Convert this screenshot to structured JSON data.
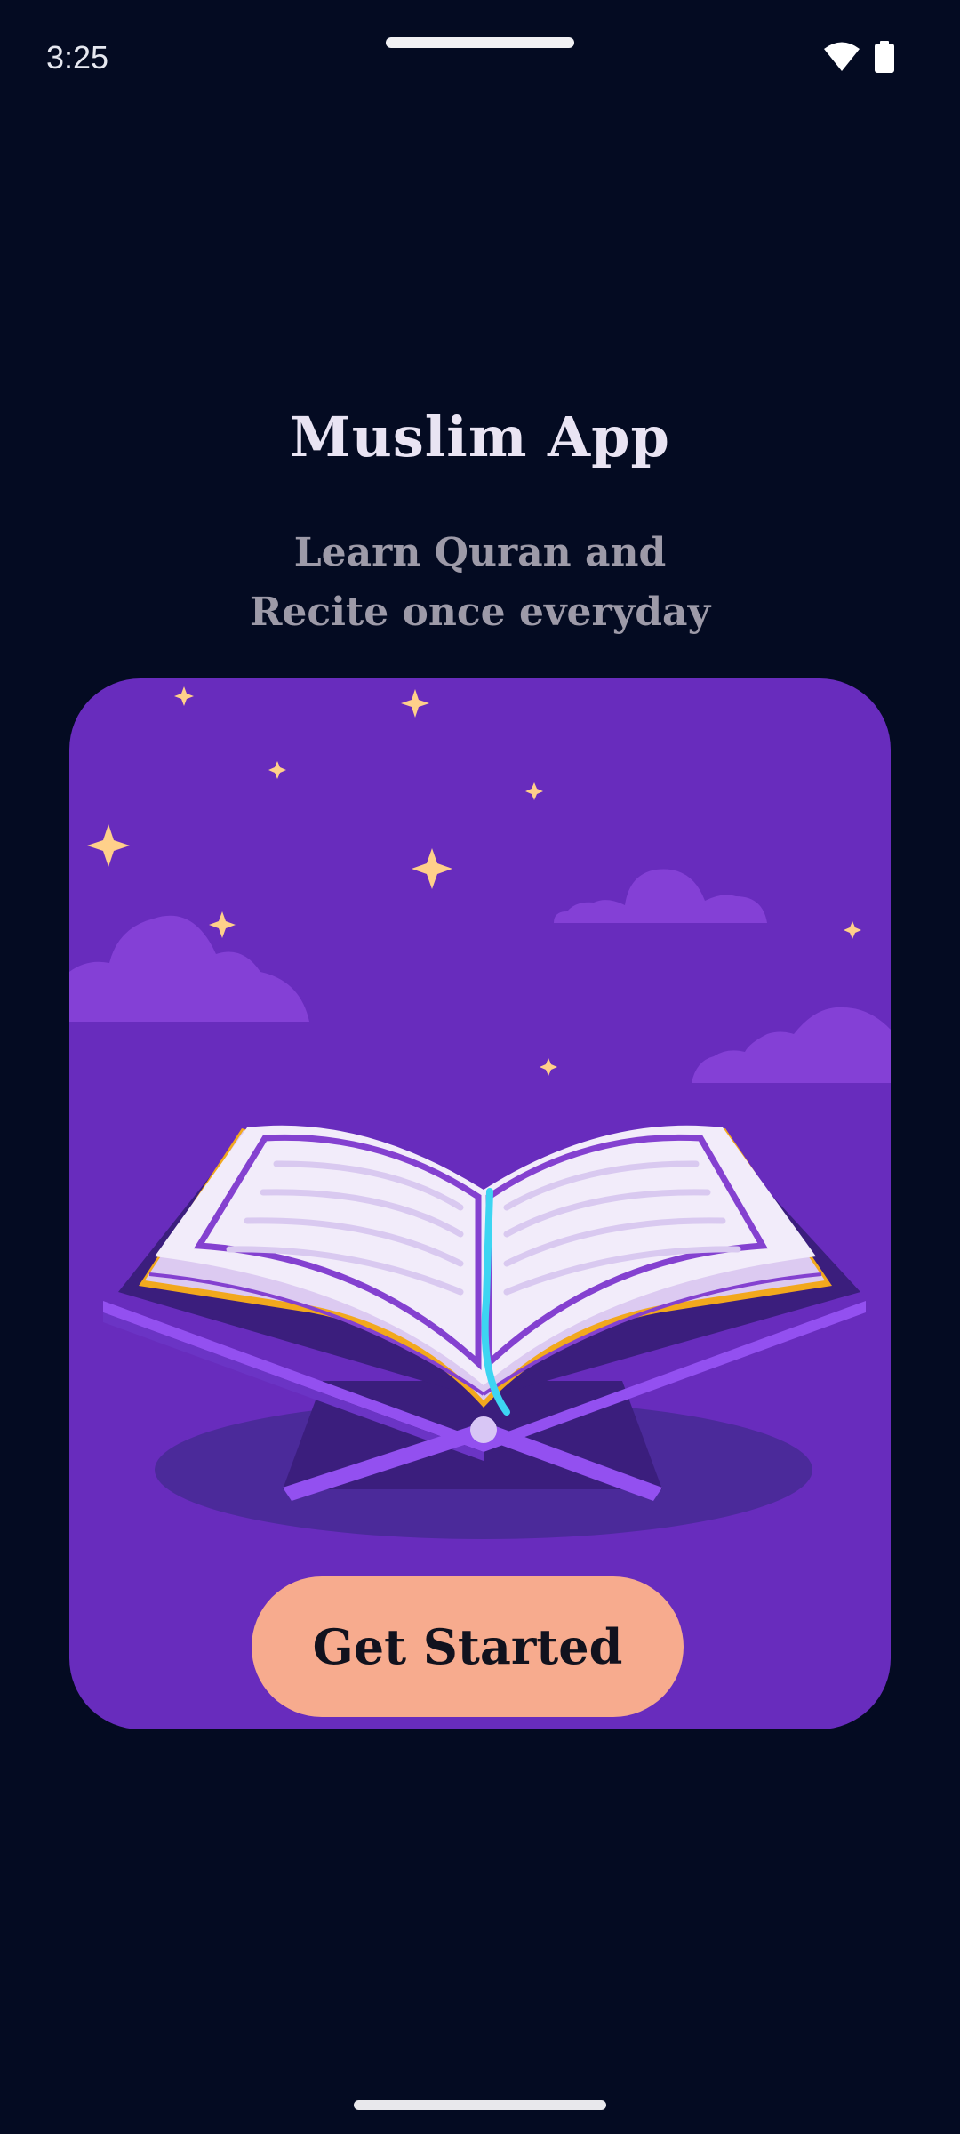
{
  "status_bar": {
    "time": "3:25",
    "icons": [
      "wifi-icon",
      "battery-icon"
    ]
  },
  "app": {
    "title": "Muslim App",
    "subtitle_line1": "Learn Quran and",
    "subtitle_line2": "Recite once everyday"
  },
  "card": {
    "illustration": "open-quran-on-stand-night-sky",
    "cta_label": "Get Started"
  },
  "colors": {
    "background": "#040B22",
    "card": "#682CBD",
    "button": "#F7AB8E",
    "star": "#FFD08A"
  }
}
